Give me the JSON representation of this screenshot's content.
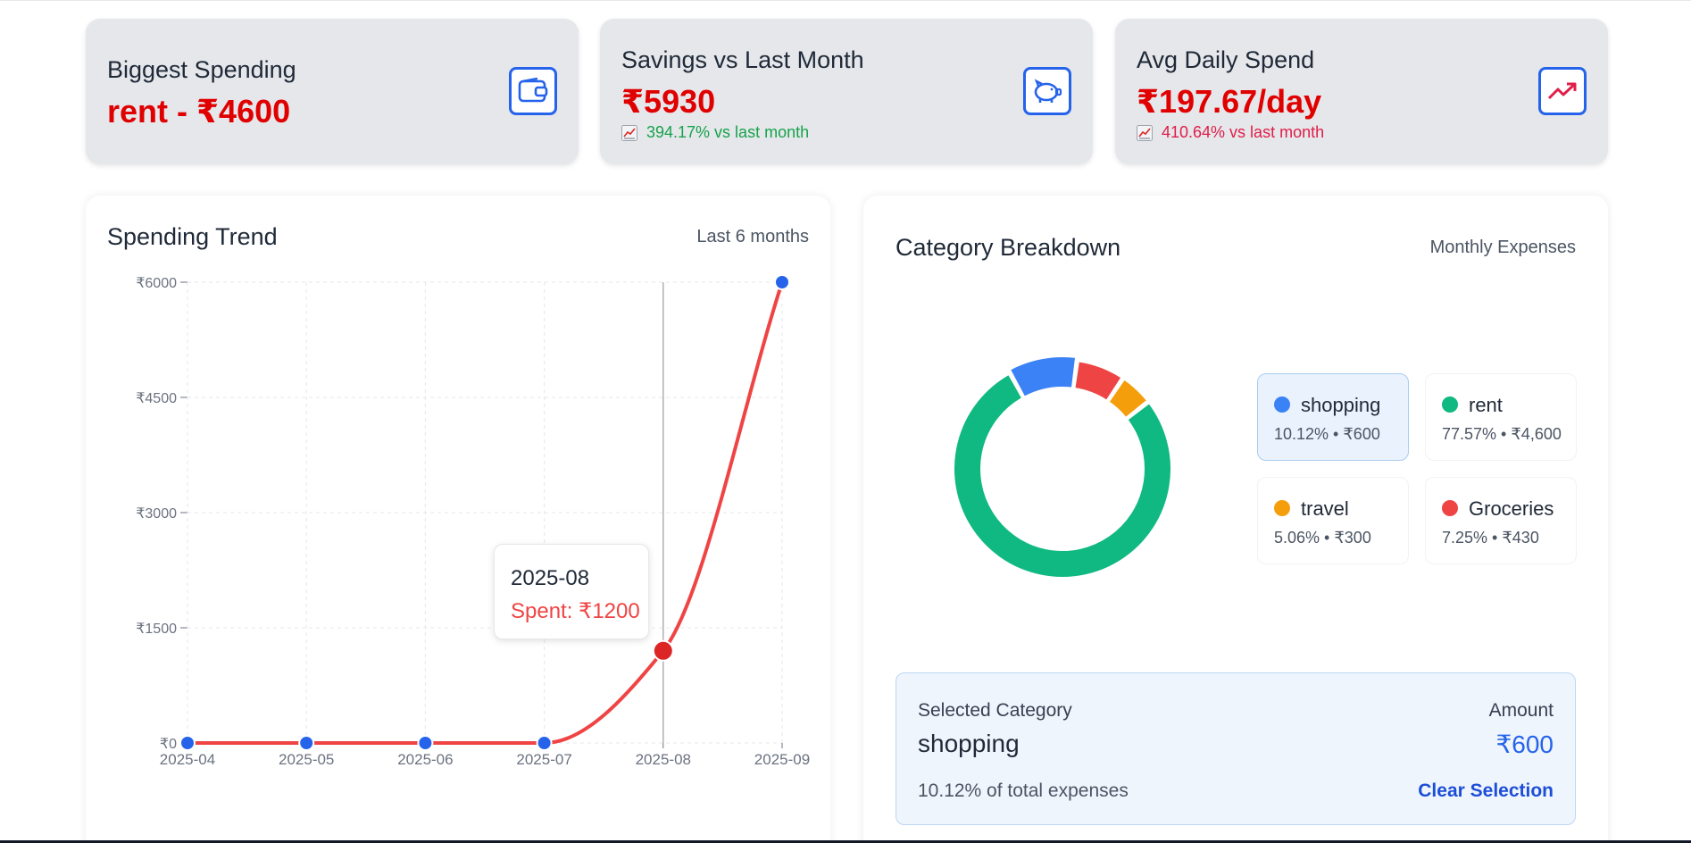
{
  "stats": {
    "biggest": {
      "title": "Biggest Spending",
      "value": "rent - ₹4600",
      "icon": "wallet-icon"
    },
    "savings": {
      "title": "Savings vs Last Month",
      "value": "₹5930",
      "change": "394.17% vs last month",
      "change_color": "#16a34a",
      "icon": "piggy-bank-icon"
    },
    "avg_daily": {
      "title": "Avg Daily Spend",
      "value": "₹197.67/day",
      "change": "410.64% vs last month",
      "change_color": "#e11d48",
      "icon": "trending-up-icon"
    }
  },
  "trend": {
    "title": "Spending Trend",
    "subtitle": "Last 6 months",
    "tooltip": {
      "date": "2025-08",
      "spent": "Spent: ₹1200"
    }
  },
  "categories": {
    "title": "Category Breakdown",
    "subtitle": "Monthly Expenses",
    "items": [
      {
        "name": "shopping",
        "detail": "10.12% • ₹600",
        "color": "#3b82f6",
        "selected": true
      },
      {
        "name": "rent",
        "detail": "77.57% • ₹4,600",
        "color": "#10b981",
        "selected": false
      },
      {
        "name": "travel",
        "detail": "5.06% • ₹300",
        "color": "#f59e0b",
        "selected": false
      },
      {
        "name": "Groceries",
        "detail": "7.25% • ₹430",
        "color": "#ef4444",
        "selected": false
      }
    ],
    "selected_panel": {
      "label": "Selected Category",
      "name": "shopping",
      "amount_label": "Amount",
      "amount": "₹600",
      "percent_text": "10.12% of total expenses",
      "clear_label": "Clear Selection"
    }
  },
  "chart_data": [
    {
      "type": "line",
      "x": [
        "2025-04",
        "2025-05",
        "2025-06",
        "2025-07",
        "2025-08",
        "2025-09"
      ],
      "series": [
        {
          "values": [
            0,
            0,
            0,
            0,
            1200,
            6000
          ],
          "color": "#ef4444"
        }
      ],
      "yticks": [
        "₹0",
        "₹1500",
        "₹3000",
        "₹4500",
        "₹6000"
      ],
      "ylim": [
        0,
        6000
      ],
      "grid": true,
      "highlight_index": 4
    },
    {
      "type": "pie",
      "categories": [
        "rent",
        "shopping",
        "Groceries",
        "travel"
      ],
      "values": [
        4600,
        600,
        430,
        300
      ],
      "colors": [
        "#10b981",
        "#3b82f6",
        "#ef4444",
        "#f59e0b"
      ]
    }
  ]
}
